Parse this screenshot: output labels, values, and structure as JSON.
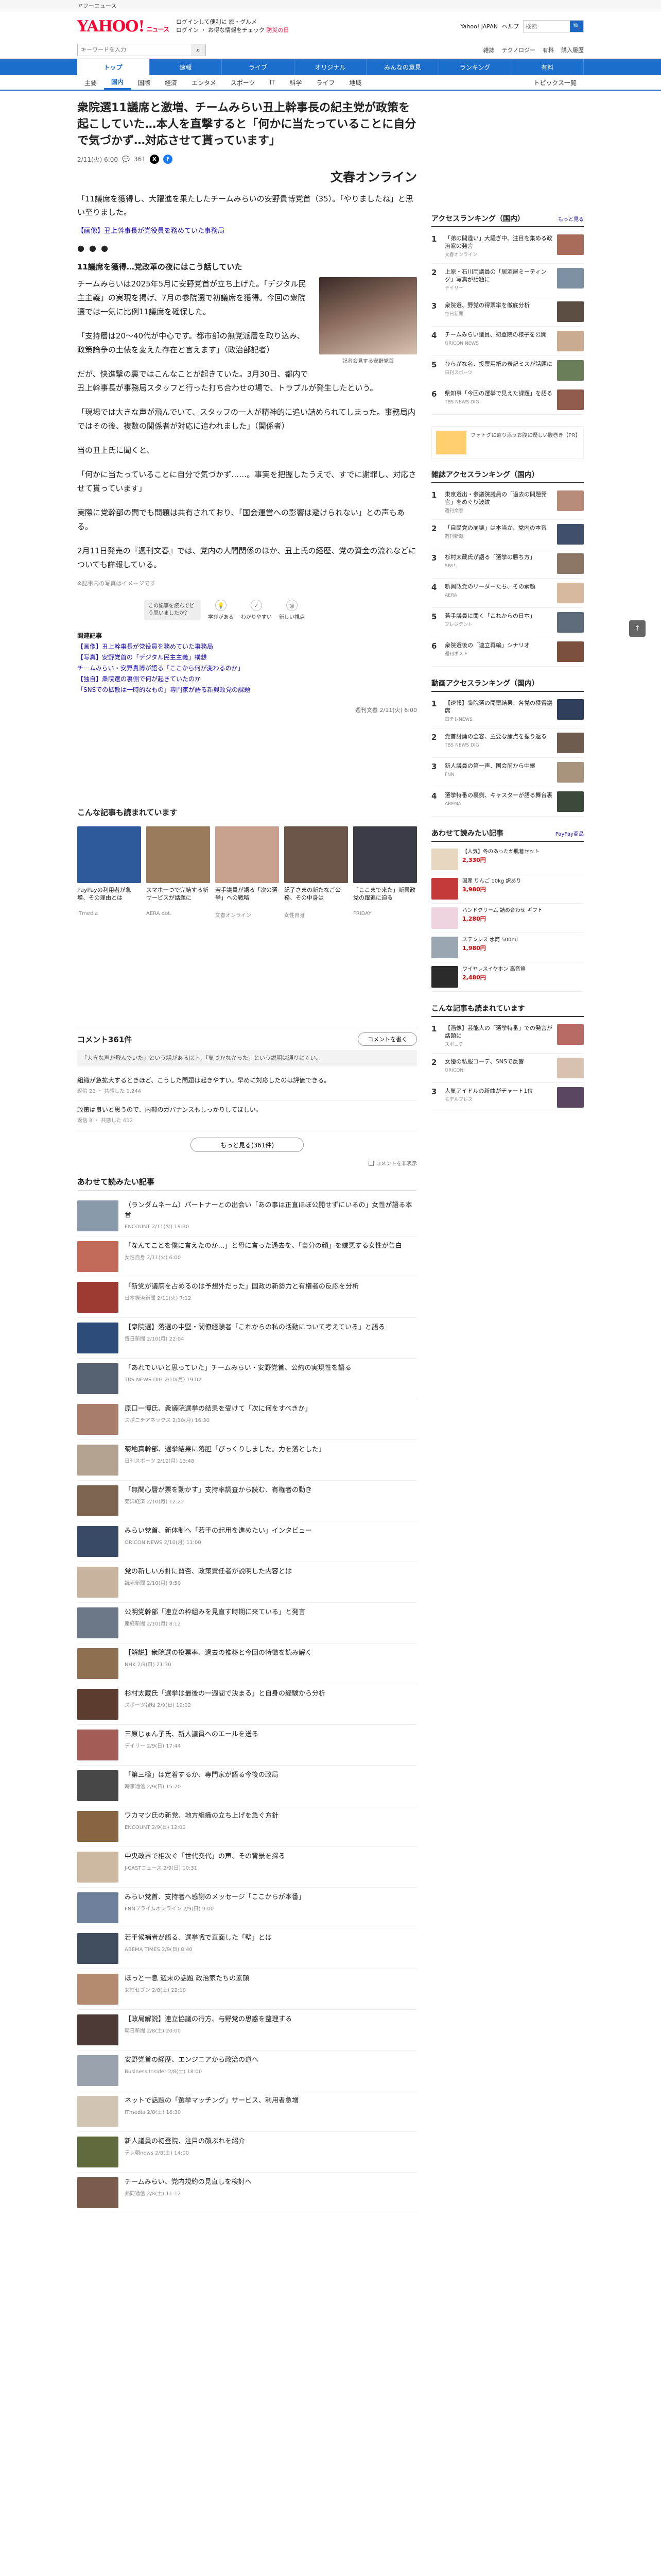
{
  "topbar": {
    "notice": "ヤフーニュース"
  },
  "header": {
    "logo": "YAHOO!",
    "logo_sub": "ニュース",
    "links_line1": "ログインして便利に  旅・グルメ",
    "links_line2": "ログイン  ・ お得な情報をチェック",
    "links_red": "防災の日",
    "jmail": "Yahoo! JAPAN",
    "help": "ヘルプ",
    "search_placeholder": "検索",
    "search_btn": "🔍"
  },
  "searchrow": {
    "placeholder": "キーワードを入力",
    "links": [
      "雑誌",
      "テクノロジー",
      "有料",
      "購入履歴"
    ]
  },
  "nav1": [
    "トップ",
    "速報",
    "ライブ",
    "オリジナル",
    "みんなの意見",
    "ランキング",
    "有料"
  ],
  "nav1_active": 0,
  "nav2": [
    "主要",
    "国内",
    "国際",
    "経済",
    "エンタメ",
    "スポーツ",
    "IT",
    "科学",
    "ライフ",
    "地域"
  ],
  "nav2_active": 1,
  "nav2_right": "トピックス一覧",
  "article": {
    "title": "衆院選11議席と激増、チームみらい丑上幹事長の紀主党が政策を起こしていた…本人を直撃すると「何かに当たっていることに自分で気づかず…対応させて貰っています」",
    "meta_date": "2/11(火) 6:00",
    "meta_comments": "361",
    "publisher": "文春オンライン",
    "lead": "「11議席を獲得し、大躍進を果たしたチームみらいの安野貴博党首（35）。「やりましたね」と思い至りました。",
    "related_inline": "【画像】丑上幹事長が党役員を務めていた事務局",
    "subhead": "11議席を獲得…党改革の夜にはこう話していた",
    "photo_caption": "記者会見する安野党首",
    "paragraphs": [
      "チームみらいは2025年5月に安野党首が立ち上げた。「デジタル民主主義」の実現を掲げ、7月の参院選で初議席を獲得。今回の衆院選では一気に比例11議席を確保した。",
      "「支持層は20〜40代が中心です。都市部の無党派層を取り込み、政策論争の土俵を変えた存在と言えます」（政治部記者）",
      "だが、快進撃の裏ではこんなことが起きていた。3月30日、都内で丑上幹事長が事務局スタッフと行った打ち合わせの場で、トラブルが発生したという。",
      "「現場では大きな声が飛んでいて、スタッフの一人が精神的に追い詰められてしまった。事務局内ではその後、複数の関係者が対応に追われました」（関係者）",
      "当の丑上氏に聞くと、",
      "「何かに当たっていることに自分で気づかず……。事実を把握したうえで、すでに謝罪し、対応させて貰っています」",
      "実際に党幹部の間でも問題は共有されており、「国会運営への影響は避けられない」との声もある。",
      "2月11日発売の『週刊文春』では、党内の人間関係のほか、丑上氏の経歴、党の資金の流れなどについても詳報している。"
    ],
    "figure_note": "※記事内の写真はイメージです",
    "reaction_prompt": "この記事を読んでどう思いましたか？",
    "reactions": [
      "学びがある",
      "わかりやすい",
      "新しい視点"
    ],
    "related_title": "関連記事",
    "related_links": [
      "【画像】丑上幹事長が党役員を務めていた事務局",
      "【写真】安野党首の「デジタル民主主義」構想",
      "チームみらい・安野貴博が語る「ここから何が変わるのか」",
      "【独自】衆院選の裏側で何が起きていたのか",
      "「SNSでの拡散は一時的なもの」専門家が語る新興政党の課題"
    ],
    "credit": "週刊文春 2/11(火) 6:00"
  },
  "more_articles_title": "こんな記事も読まれています",
  "cards": [
    {
      "title": "PayPayの利用者が急増、その理由とは",
      "source": "ITmedia",
      "color": "#2d5a9b"
    },
    {
      "title": "スマホ一つで完結する新サービスが話題に",
      "source": "AERA dot.",
      "color": "#9a7b5c"
    },
    {
      "title": "若手議員が語る「次の選挙」への戦略",
      "source": "文春オンライン",
      "color": "#c7a18d"
    },
    {
      "title": "紀子さまの新たなご公務、その中身は",
      "source": "女性自身",
      "color": "#6b5448"
    },
    {
      "title": "「ここまで来た」新興政党の躍進に迫る",
      "source": "FRIDAY",
      "color": "#3c3c46"
    }
  ],
  "comments": {
    "title": "コメント361件",
    "write_btn": "コメントを書く",
    "note": "「大きな声が飛んでいた」という話がある以上、「気づかなかった」という説明は通りにくい。",
    "items": [
      {
        "text": "組織が急拡大するときほど、こうした問題は起きやすい。早めに対応したのは評価できる。",
        "meta": "返信 23 ・ 共感した 1,244"
      },
      {
        "text": "政策は良いと思うので、内部のガバナンスもしっかりしてほしい。",
        "meta": "返信 8 ・ 共感した 612"
      }
    ],
    "more_btn": "もっと見る(361件)",
    "check_label": "コメントを非表示"
  },
  "list_title": "あわせて読みたい記事",
  "news_list": [
    {
      "title": "（ランダムネーム）パートナーとの出会い「あの事は正直ほぼ公開せずにいるの」女性が語る本音",
      "source": "ENCOUNT 2/11(火) 18:30",
      "color": "#8a9aab"
    },
    {
      "title": "「なんてことを僕に言えたのか…」と母に言った過去を、「自分の顔」を嫌悪する女性が告白",
      "source": "女性自身 2/11(火) 6:00",
      "color": "#c46a5a"
    },
    {
      "title": "「新党が議席を占めるのは予想外だった」国政の新勢力と有権者の反応を分析",
      "source": "日本経済新聞 2/11(火) 7:12",
      "color": "#9c3b34"
    },
    {
      "title": "【衆院選】落選の中堅・閣僚経験者「これからの私の活動について考えている」と語る",
      "source": "毎日新聞 2/10(月) 22:04",
      "color": "#2e4c7a"
    },
    {
      "title": "「あれでいいと思っていた」チームみらい・安野党首、公約の実現性を語る",
      "source": "TBS NEWS DIG 2/10(月) 19:02",
      "color": "#556070"
    },
    {
      "title": "原口一博氏、衆議院選挙の結果を受けて「次に何をすべきか」",
      "source": "スポニチアネックス 2/10(月) 16:30",
      "color": "#a87e6a"
    },
    {
      "title": "菊地真幹部、選挙結果に落胆「びっくりしました。力を落とした」",
      "source": "日刊スポーツ 2/10(月) 13:48",
      "color": "#b3a290"
    },
    {
      "title": "「無関心層が票を動かす」支持率調査から読む、有権者の動き",
      "source": "東洋経済 2/10(月) 12:22",
      "color": "#7c6450"
    },
    {
      "title": "みらい党首、新体制へ「若手の起用を進めたい」インタビュー",
      "source": "ORICON NEWS 2/10(月) 11:00",
      "color": "#384a66"
    },
    {
      "title": "党の新しい方針に賛否、政策責任者が説明した内容とは",
      "source": "読売新聞 2/10(月) 9:50",
      "color": "#c8b49e"
    },
    {
      "title": "公明党幹部「連立の枠組みを見直す時期に来ている」と発言",
      "source": "産経新聞 2/10(月) 8:12",
      "color": "#6c7888"
    },
    {
      "title": "【解説】衆院選の投票率、過去の推移と今回の特徴を読み解く",
      "source": "NHK 2/9(日) 21:30",
      "color": "#8f6f52"
    },
    {
      "title": "杉村太蔵氏「選挙は最後の一週間で決まる」と自身の経験から分析",
      "source": "スポーツ報知 2/9(日) 19:02",
      "color": "#5b3c2f"
    },
    {
      "title": "三原じゅん子氏、新人議員へのエールを送る",
      "source": "デイリー 2/9(日) 17:44",
      "color": "#a35c56"
    },
    {
      "title": "「第三極」は定着するか、専門家が語る今後の政局",
      "source": "時事通信 2/9(日) 15:20",
      "color": "#474747"
    },
    {
      "title": "ワカマツ氏の新党、地方組織の立ち上げを急ぐ方針",
      "source": "ENCOUNT 2/9(日) 12:00",
      "color": "#876543"
    },
    {
      "title": "中央政界で相次ぐ「世代交代」の声、その背景を探る",
      "source": "J-CASTニュース 2/9(日) 10:31",
      "color": "#cdb9a2"
    },
    {
      "title": "みらい党首、支持者へ感謝のメッセージ「ここからが本番」",
      "source": "FNNプライムオンライン 2/9(日) 9:00",
      "color": "#6e7f99"
    },
    {
      "title": "若手候補者が語る、選挙戦で直面した「壁」とは",
      "source": "ABEMA TIMES 2/9(日) 8:40",
      "color": "#3f4d5e"
    },
    {
      "title": "ほっと一息 週末の話題 政治家たちの素顔",
      "source": "女性セブン 2/8(土) 22:10",
      "color": "#b48b70"
    },
    {
      "title": "【政局解説】連立協議の行方、与野党の思惑を整理する",
      "source": "朝日新聞 2/8(土) 20:00",
      "color": "#4b3a36"
    },
    {
      "title": "安野党首の経歴、エンジニアから政治の道へ",
      "source": "Business Insider 2/8(土) 18:00",
      "color": "#9aa3ad"
    },
    {
      "title": "ネットで話題の「選挙マッチング」サービス、利用者急増",
      "source": "ITmedia 2/8(土) 16:30",
      "color": "#d2c4b2"
    },
    {
      "title": "新人議員の初登院、注目の顔ぶれを紹介",
      "source": "テレ朝news 2/8(土) 14:00",
      "color": "#5f6a3e"
    },
    {
      "title": "チームみらい、党内規約の見直しを検討へ",
      "source": "共同通信 2/8(土) 11:12",
      "color": "#7a5c4c"
    }
  ],
  "sidebar": {
    "access_title": "アクセスランキング（国内）",
    "access_more": "もっと見る",
    "access": [
      {
        "title": "「弟の間違い」大騒ぎ中、注目を集める政治家の発言",
        "source": "文春オンライン",
        "color": "#a86c5a"
      },
      {
        "title": "上原・石川両議員の「居酒屋ミーティング」写真が話題に",
        "source": "デイリー",
        "color": "#7d8fa3"
      },
      {
        "title": "衆院選、野党の得票率を徹底分析",
        "source": "毎日新聞",
        "color": "#5b4d42"
      },
      {
        "title": "チームみらい議員、初登院の様子を公開",
        "source": "ORICON NEWS",
        "color": "#c9ab91"
      },
      {
        "title": "ひらがな名、投票用紙の表記ミスが話題に",
        "source": "日刊スポーツ",
        "color": "#6b7e5a"
      },
      {
        "title": "県知事「今回の選挙で見えた課題」を語る",
        "source": "TBS NEWS DIG",
        "color": "#8f5b4a"
      }
    ],
    "ad_text": "フォトグに寄り添うお腹に優しい腹巻き【PR】",
    "social_title": "雑誌アクセスランキング（国内）",
    "social": [
      {
        "title": "東京選出・参議院議員の「過去の問題発言」をめぐり波紋",
        "source": "週刊文春",
        "color": "#b88a78"
      },
      {
        "title": "「自民党の崩壊」は本当か、党内の本音",
        "source": "週刊新潮",
        "color": "#40506a"
      },
      {
        "title": "杉村太蔵氏が語る「選挙の勝ち方」",
        "source": "SPA!",
        "color": "#8c7666"
      },
      {
        "title": "新興政党のリーダーたち、その素顔",
        "source": "AERA",
        "color": "#d6b99f"
      },
      {
        "title": "若手議員に聞く「これからの日本」",
        "source": "プレジデント",
        "color": "#5e6b78"
      },
      {
        "title": "衆院選後の「連立再編」シナリオ",
        "source": "週刊ポスト",
        "color": "#7b4f3b"
      }
    ],
    "video_title": "動画アクセスランキング（国内）",
    "videos": [
      {
        "title": "【速報】衆院選の開票結果、各党の獲得議席",
        "source": "日テレNEWS",
        "color": "#2f3f5c"
      },
      {
        "title": "党首討論の全容、主要な論点を振り返る",
        "source": "TBS NEWS DIG",
        "color": "#6e5c4e"
      },
      {
        "title": "新人議員の第一声、国会前から中継",
        "source": "FNN",
        "color": "#a8937c"
      },
      {
        "title": "選挙特番の裏側、キャスターが語る舞台裏",
        "source": "ABEMA",
        "color": "#3b4a3a"
      }
    ],
    "shop_title": "あわせて読みたい記事",
    "shop_badge": "PayPay商品",
    "shop": [
      {
        "title": "【人気】冬のあったか肌着セット",
        "price": "2,330円",
        "color": "#e8d7c0"
      },
      {
        "title": "国産 りんご 10kg 訳あり",
        "price": "3,980円",
        "color": "#c43a3a"
      },
      {
        "title": "ハンドクリーム 詰め合わせ ギフト",
        "price": "1,280円",
        "color": "#efd4df"
      },
      {
        "title": "ステンレス 水筒 500ml",
        "price": "1,980円",
        "color": "#9aa6b2"
      },
      {
        "title": "ワイヤレスイヤホン 高音質",
        "price": "2,480円",
        "color": "#2b2b2b"
      }
    ],
    "ent_title": "こんな記事も読まれています",
    "ent": [
      {
        "title": "【画像】芸能人の「選挙特番」での発言が話題に",
        "source": "スポニチ",
        "color": "#b76b64"
      },
      {
        "title": "女優の私服コーデ、SNSで反響",
        "source": "ORICON",
        "color": "#d9c1b1"
      },
      {
        "title": "人気アイドルの新曲がチャート1位",
        "source": "モデルプレス",
        "color": "#5a4660"
      }
    ]
  }
}
